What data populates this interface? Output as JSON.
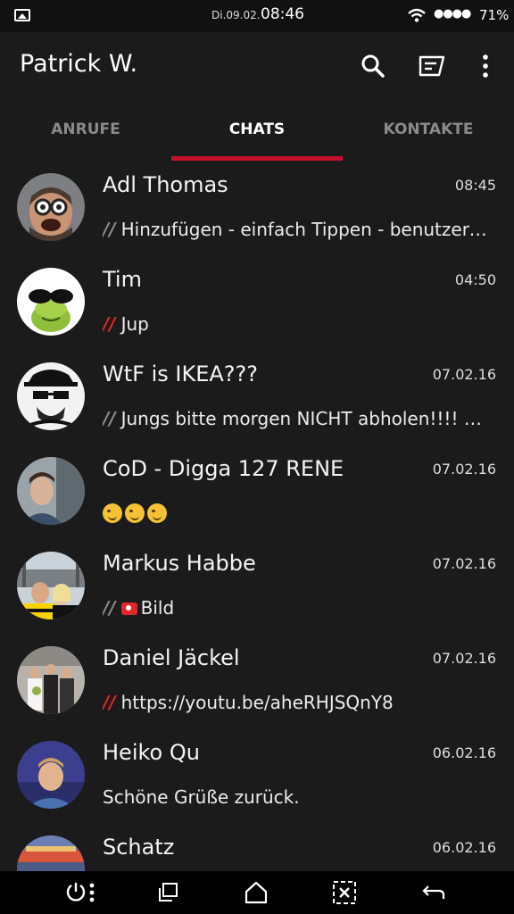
{
  "status_bar": {
    "date": "Di.09.02.",
    "time": "08:46",
    "signal": "●●●●",
    "battery": "71%"
  },
  "header": {
    "title": "Patrick W.",
    "icons": [
      "search-icon",
      "compose-icon",
      "more-icon"
    ]
  },
  "tabs": [
    {
      "label": "ANRUFE",
      "active": false
    },
    {
      "label": "CHATS",
      "active": true
    },
    {
      "label": "KONTAKTE",
      "active": false
    }
  ],
  "accent_color": "#c8102e",
  "chats": [
    {
      "name": "Adl Thomas",
      "time": "08:45",
      "ticks": "//",
      "tick_state": "sent",
      "preview": "Hinzufügen - einfach Tippen - benutzerdefinierte Nachricht"
    },
    {
      "name": "Tim",
      "time": "04:50",
      "ticks": "//",
      "tick_state": "read",
      "preview": "Jup"
    },
    {
      "name": "WtF is IKEA???",
      "time": "07.02.16",
      "ticks": "//",
      "tick_state": "sent",
      "preview": "Jungs bitte morgen NICHT abholen!!!! Morgen"
    },
    {
      "name": "CoD - Digga 127 RENE",
      "time": "07.02.16",
      "ticks": "",
      "tick_state": "none",
      "preview": ""
    },
    {
      "name": "Markus Habbe",
      "time": "07.02.16",
      "ticks": "//",
      "tick_state": "sent",
      "preview": "Bild"
    },
    {
      "name": "Daniel Jäckel",
      "time": "07.02.16",
      "ticks": "//",
      "tick_state": "read",
      "preview": "https://youtu.be/aheRHJSQnY8"
    },
    {
      "name": "Heiko Qu",
      "time": "06.02.16",
      "ticks": "",
      "tick_state": "none",
      "preview": "Schöne Grüße zurück."
    },
    {
      "name": "Schatz",
      "time": "06.02.16",
      "ticks": "",
      "tick_state": "none",
      "preview": ""
    }
  ],
  "nav_bar": {
    "icons": [
      "power-menu-icon",
      "recent-apps-icon",
      "home-icon",
      "close-app-icon",
      "back-icon"
    ]
  }
}
